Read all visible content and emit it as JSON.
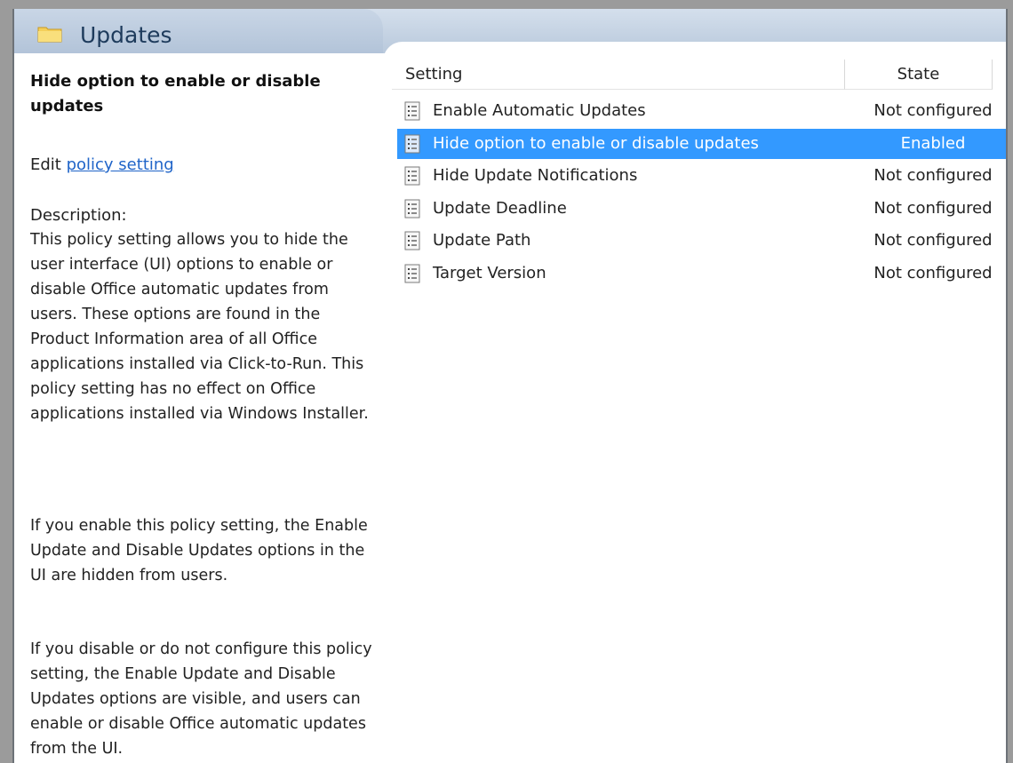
{
  "header": {
    "title": "Updates",
    "icon": "folder-icon"
  },
  "details": {
    "title": "Hide option to enable or disable updates",
    "edit_prefix": "Edit",
    "edit_link": "policy setting",
    "description_label": "Description:",
    "paragraphs": [
      "This policy setting allows you to hide the user interface (UI) options to enable or disable Office automatic updates from users. These options are found in the Product Information area of all Office applications installed via Click-to-Run. This policy setting has no effect on Office applications installed via Windows Installer.",
      "If you enable this policy setting, the Enable Update and Disable Updates options in the UI are hidden from users.",
      "If you disable or do not configure this policy setting, the Enable Update and Disable Updates options are visible, and users can enable or disable Office automatic updates from the UI."
    ]
  },
  "table": {
    "columns": [
      "Setting",
      "State"
    ],
    "rows": [
      {
        "name": "Enable Automatic Updates",
        "state": "Not configured",
        "icon": "policy-doc-icon"
      },
      {
        "name": "Hide option to enable or disable updates",
        "state": "Enabled",
        "icon": "policy-doc-icon",
        "selected": true
      },
      {
        "name": "Hide Update Notifications",
        "state": "Not configured",
        "icon": "policy-doc-icon"
      },
      {
        "name": "Update Deadline",
        "state": "Not configured",
        "icon": "policy-doc-icon"
      },
      {
        "name": "Update Path",
        "state": "Not configured",
        "icon": "policy-doc-icon"
      },
      {
        "name": "Target Version",
        "state": "Not configured",
        "icon": "policy-doc-icon"
      }
    ]
  },
  "colors": {
    "selection": "#3399ff",
    "link": "#1f64c8",
    "header": "#b9c9dc"
  }
}
